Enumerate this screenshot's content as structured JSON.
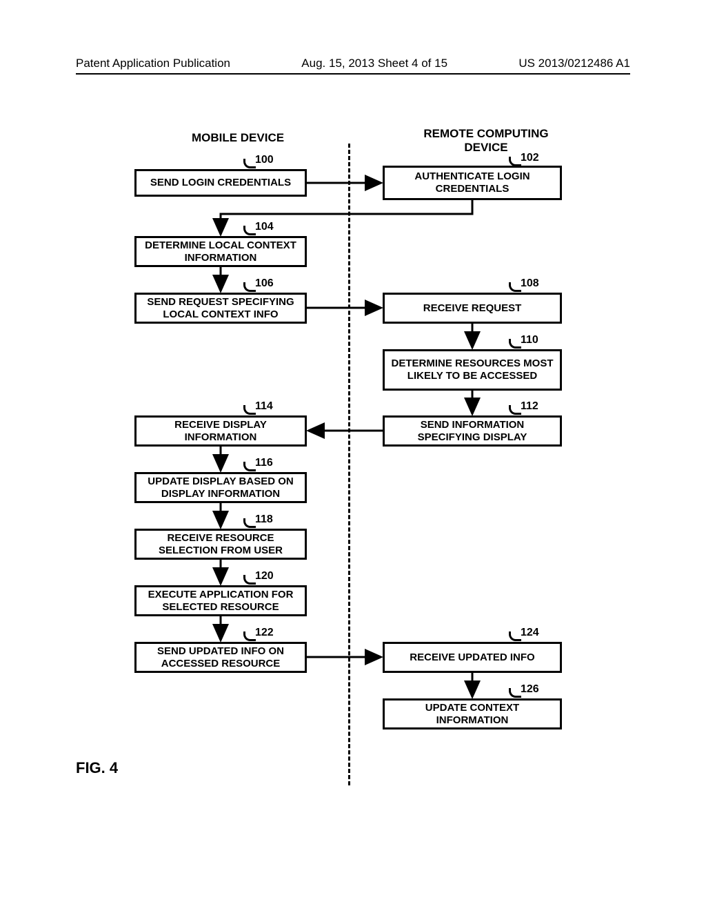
{
  "header": {
    "left": "Patent Application Publication",
    "center": "Aug. 15, 2013  Sheet 4 of 15",
    "right": "US 2013/0212486 A1"
  },
  "columns": {
    "left_title": "MOBILE DEVICE",
    "right_title": "REMOTE COMPUTING DEVICE"
  },
  "boxes": {
    "b100": "SEND LOGIN CREDENTIALS",
    "b102": "AUTHENTICATE LOGIN CREDENTIALS",
    "b104": "DETERMINE LOCAL CONTEXT INFORMATION",
    "b106": "SEND REQUEST SPECIFYING LOCAL CONTEXT INFO",
    "b108": "RECEIVE REQUEST",
    "b110": "DETERMINE RESOURCES MOST LIKELY TO BE ACCESSED",
    "b112": "SEND INFORMATION SPECIFYING DISPLAY",
    "b114": "RECEIVE DISPLAY INFORMATION",
    "b116": "UPDATE DISPLAY BASED ON DISPLAY INFORMATION",
    "b118": "RECEIVE RESOURCE SELECTION FROM USER",
    "b120": "EXECUTE APPLICATION FOR SELECTED RESOURCE",
    "b122": "SEND UPDATED INFO ON ACCESSED RESOURCE",
    "b124": "RECEIVE UPDATED INFO",
    "b126": "UPDATE CONTEXT INFORMATION"
  },
  "refs": {
    "r100": "100",
    "r102": "102",
    "r104": "104",
    "r106": "106",
    "r108": "108",
    "r110": "110",
    "r112": "112",
    "r114": "114",
    "r116": "116",
    "r118": "118",
    "r120": "120",
    "r122": "122",
    "r124": "124",
    "r126": "126"
  },
  "figure_label": "FIG. 4"
}
